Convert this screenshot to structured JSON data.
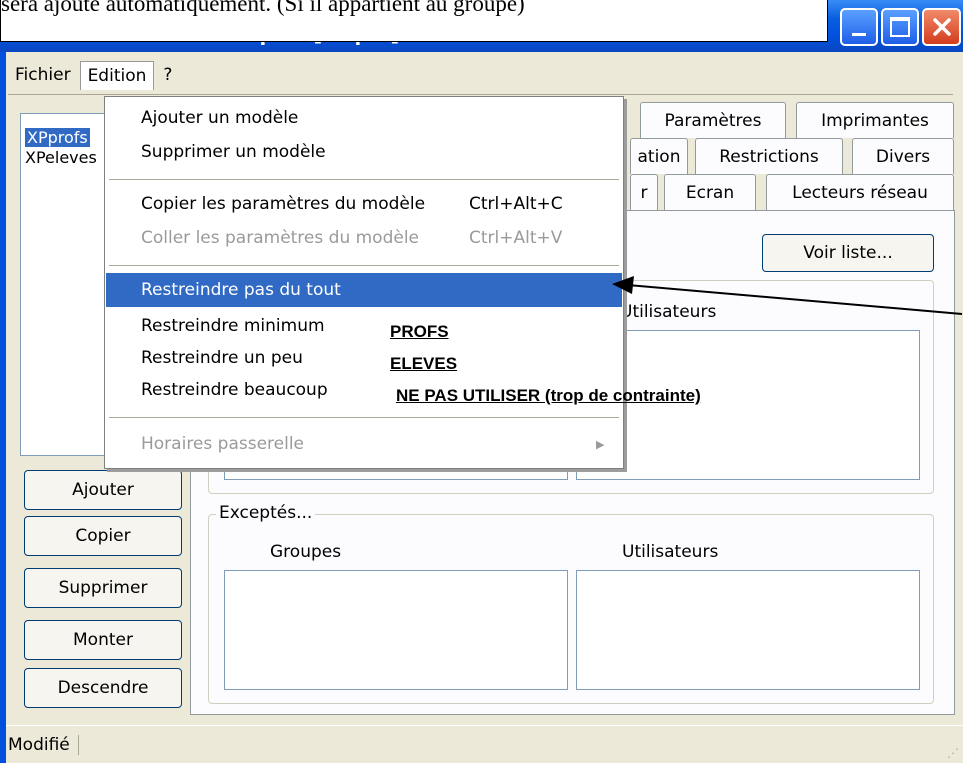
{
  "annotation": {
    "top_note": "sera ajouté automatiquement. (Si il appartient au groupe)",
    "profs_label": "PROFS",
    "eleves_label": "ELEVES",
    "avoid_label": "NE PAS UTILISER (trop de contrainte)"
  },
  "window": {
    "title": "Modèles liés au sous-parc [ampro] du domaine ...",
    "controls": [
      "minimize-icon",
      "maximize-icon",
      "close-icon"
    ]
  },
  "menubar": {
    "items": [
      "Fichier",
      "Edition",
      "?"
    ]
  },
  "models_list": [
    "XPprofs",
    "XPeleves"
  ],
  "left_buttons": [
    "Ajouter",
    "Copier",
    "Supprimer",
    "Monter",
    "Descendre"
  ],
  "tabs": {
    "row1": [
      "Paramètres",
      "Imprimantes"
    ],
    "row2": [
      "ation",
      "Restrictions",
      "Divers"
    ],
    "row3": [
      "r",
      "Ecran",
      "Lecteurs réseau"
    ]
  },
  "panel": {
    "voir_liste": "Voir liste...",
    "upper_col_utilisateurs": "Utilisateurs",
    "exceptes_title": "Exceptés...",
    "col_groupes": "Groupes",
    "col_utilisateurs": "Utilisateurs"
  },
  "edition_menu": {
    "items": [
      {
        "label": "Ajouter un modèle",
        "shortcut": "",
        "disabled": false
      },
      {
        "label": "Supprimer un modèle",
        "shortcut": "",
        "disabled": false
      },
      {
        "label": "Copier les paramètres du modèle",
        "shortcut": "Ctrl+Alt+C",
        "disabled": false
      },
      {
        "label": "Coller les paramètres du modèle",
        "shortcut": "Ctrl+Alt+V",
        "disabled": true
      },
      {
        "label": "Restreindre pas du tout",
        "shortcut": "",
        "disabled": false,
        "highlighted": true
      },
      {
        "label": "Restreindre minimum",
        "shortcut": "",
        "disabled": false
      },
      {
        "label": "Restreindre un peu",
        "shortcut": "",
        "disabled": false
      },
      {
        "label": "Restreindre beaucoup",
        "shortcut": "",
        "disabled": false
      },
      {
        "label": "Horaires passerelle",
        "shortcut": "",
        "disabled": true,
        "submenu": true
      }
    ]
  },
  "statusbar": {
    "text": "Modifié"
  },
  "colors": {
    "highlight": "#316ac5",
    "titlebar": "#0050dd",
    "client": "#ece9d8"
  }
}
